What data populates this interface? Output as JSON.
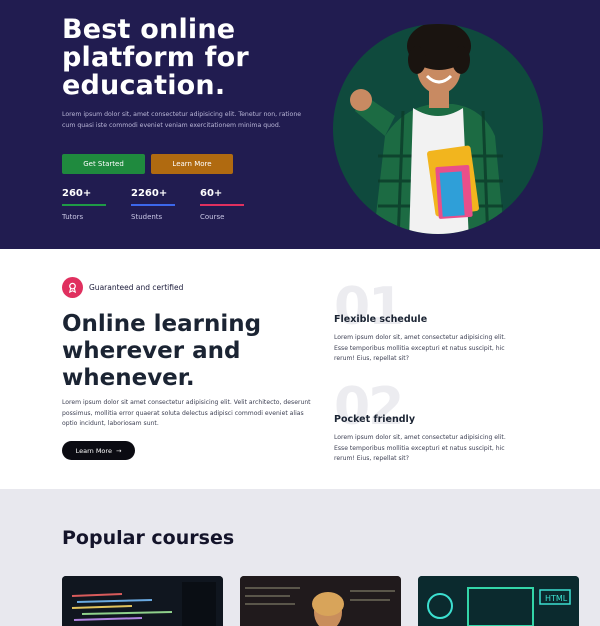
{
  "hero": {
    "title": "Best online platform for education.",
    "description": "Lorem ipsum dolor sit, amet consectetur adipisicing elit. Tenetur non, ratione cum quasi iste commodi eveniet veniam exercitationem minima quod.",
    "primary_button": "Get Started",
    "secondary_button": "Learn More",
    "stats": [
      {
        "value": "260+",
        "label": "Tutors"
      },
      {
        "value": "2260+",
        "label": "Students"
      },
      {
        "value": "60+",
        "label": "Course"
      }
    ]
  },
  "about": {
    "badge_label": "Guaranteed and certified",
    "title": "Online learning wherever and whenever.",
    "description": "Lorem ipsum dolor sit amet consectetur adipisicing elit. Velit architecto, deserunt possimus, mollitia error quaerat soluta delectus adipisci commodi eveniet alias optio incidunt, laboriosam sunt.",
    "button_label": "Learn More",
    "features": [
      {
        "number": "01",
        "title": "Flexible schedule",
        "description": "Lorem ipsum dolor sit, amet consectetur adipisicing elit. Esse temporibus mollitia excepturi et natus suscipit, hic rerum! Eius, repellat sit?"
      },
      {
        "number": "02",
        "title": "Pocket friendly",
        "description": "Lorem ipsum dolor sit, amet consectetur adipisicing elit. Esse temporibus mollitia excepturi et natus suscipit, hic rerum! Eius, repellat sit?"
      }
    ]
  },
  "courses": {
    "title": "Popular courses"
  },
  "colors": {
    "hero_bg": "#211c50",
    "green": "#1f8a3e",
    "orange": "#b06a10",
    "pink": "#e0305f",
    "blue": "#3c67ea"
  }
}
